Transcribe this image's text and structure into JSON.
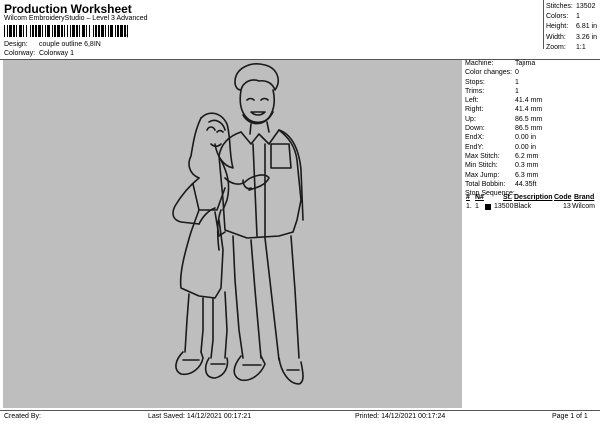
{
  "header": {
    "title": "Production Worksheet",
    "subtitle": "Wilcom EmbroideryStudio – Level 3 Advanced",
    "barcode_suffix": ","
  },
  "meta": {
    "design_label": "Design:",
    "design_value": "couple outline 6,8IN",
    "colorway_label": "Colorway:",
    "colorway_value": "Colorway 1"
  },
  "stats": [
    {
      "k": "Stitches:",
      "v": "13502"
    },
    {
      "k": "Colors:",
      "v": "1"
    },
    {
      "k": "Height:",
      "v": "6.81 in"
    },
    {
      "k": "Width:",
      "v": "3.26 in"
    },
    {
      "k": "Zoom:",
      "v": "1:1"
    }
  ],
  "info": [
    {
      "k": "Machine:",
      "v": "Tajima"
    },
    {
      "k": "Color changes:",
      "v": "0"
    },
    {
      "k": "Stops:",
      "v": "1"
    },
    {
      "k": "Trims:",
      "v": "1"
    },
    {
      "k": "Left:",
      "v": "41.4 mm"
    },
    {
      "k": "Right:",
      "v": "41.4 mm"
    },
    {
      "k": "Up:",
      "v": "86.5 mm"
    },
    {
      "k": "Down:",
      "v": "86.5 mm"
    },
    {
      "k": "EndX:",
      "v": "0.00 in"
    },
    {
      "k": "EndY:",
      "v": "0.00 in"
    },
    {
      "k": "Max Stitch:",
      "v": "6.2 mm"
    },
    {
      "k": "Min Stitch:",
      "v": "0.3 mm"
    },
    {
      "k": "Max Jump:",
      "v": "6.3 mm"
    },
    {
      "k": "Total Bobbin:",
      "v": "44.35ft"
    }
  ],
  "sequence": {
    "label": "Stop Sequence:",
    "headers": {
      "num": "#",
      "n": "N#",
      "st": "St.",
      "desc": "Description",
      "code": "Code",
      "brand": "Brand"
    },
    "rows": [
      {
        "num": "1.",
        "n": "1",
        "st": "13500",
        "desc": "Black",
        "code": "13",
        "brand": "Wilcom",
        "color": "#000000"
      }
    ]
  },
  "footer": {
    "created": "Created By:",
    "saved": "Last Saved: 14/12/2021 00:17:21",
    "printed": "Printed: 14/12/2021 00:17:24",
    "page": "Page 1 of 1"
  },
  "colors": {
    "canvas": "#bebebe",
    "thread": "#1a1a1a"
  }
}
